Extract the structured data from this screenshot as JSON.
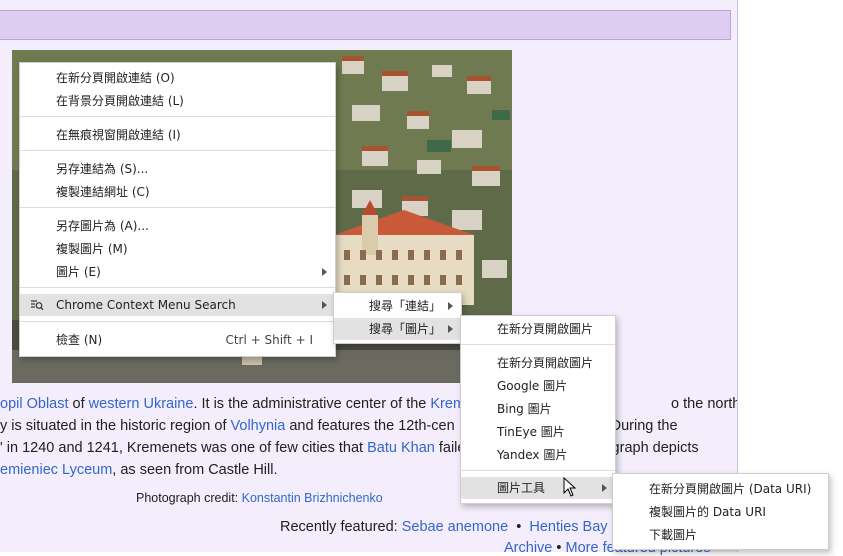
{
  "article": {
    "line1": [
      {
        "t": "opil Oblast",
        "link": true
      },
      {
        "t": " of ",
        "link": false
      },
      {
        "t": "western Ukraine",
        "link": true
      },
      {
        "t": ". It is the administrative center of the ",
        "link": false
      },
      {
        "t": "Krem",
        "link": true
      },
      {
        "t": "                                        ",
        "link": false
      },
      {
        "t": "o the north-east",
        "link": false
      }
    ],
    "line2": [
      {
        "t": "y is situated in the historic region of ",
        "link": false
      },
      {
        "t": "Volhynia",
        "link": true
      },
      {
        "t": " and features the 12th-cen",
        "link": false
      },
      {
        "t": "                              ",
        "link": false
      },
      {
        "t": "During the",
        "link": false
      }
    ],
    "line3": [
      {
        "t": "' in 1240 and 1241, Kremenets was one of few cities that ",
        "link": false
      },
      {
        "t": "Batu Khan",
        "link": true
      },
      {
        "t": " faile",
        "link": false
      },
      {
        "t": "                        ",
        "link": false
      },
      {
        "t": "ograph depicts",
        "link": false
      }
    ],
    "line4": [
      {
        "t": "emieniec Lyceum",
        "link": true
      },
      {
        "t": ", as seen from Castle Hill.",
        "link": false
      }
    ],
    "credit_label": "Photograph credit: ",
    "credit_name": "Konstantin Brizhnichenko",
    "recent_label": "Recently featured: ",
    "recent_1": "Sebae anemone",
    "recent_sep": "•",
    "recent_2": "Henties Bay",
    "archive": "Archive",
    "more": "More featured pictures"
  },
  "context_menu": {
    "items": [
      {
        "label": "在新分頁開啟連結 (O)"
      },
      {
        "label": "在背景分頁開啟連結 (L)"
      },
      {
        "label": "在無痕視窗開啟連結 (I)"
      },
      {
        "label": "另存連結為 (S)..."
      },
      {
        "label": "複製連結網址 (C)"
      },
      {
        "label": "另存圖片為 (A)..."
      },
      {
        "label": "複製圖片 (M)"
      },
      {
        "label": "圖片 (E)"
      },
      {
        "label": "Chrome Context Menu Search"
      },
      {
        "label": "檢查 (N)",
        "shortcut": "Ctrl + Shift + I"
      }
    ]
  },
  "search_submenu": {
    "items": [
      {
        "label": "搜尋「連結」"
      },
      {
        "label": "搜尋「圖片」"
      }
    ]
  },
  "image_submenu": {
    "items": [
      {
        "label": "在新分頁開啟圖片"
      },
      {
        "label": "在新分頁開啟圖片"
      },
      {
        "label": "Google 圖片"
      },
      {
        "label": "Bing 圖片"
      },
      {
        "label": "TinEye 圖片"
      },
      {
        "label": "Yandex 圖片"
      },
      {
        "label": "圖片工具"
      }
    ]
  },
  "tools_submenu": {
    "items": [
      {
        "label": "在新分頁開啟圖片 (Data URI)"
      },
      {
        "label": "複製圖片的 Data URI"
      },
      {
        "label": "下載圖片"
      }
    ]
  }
}
